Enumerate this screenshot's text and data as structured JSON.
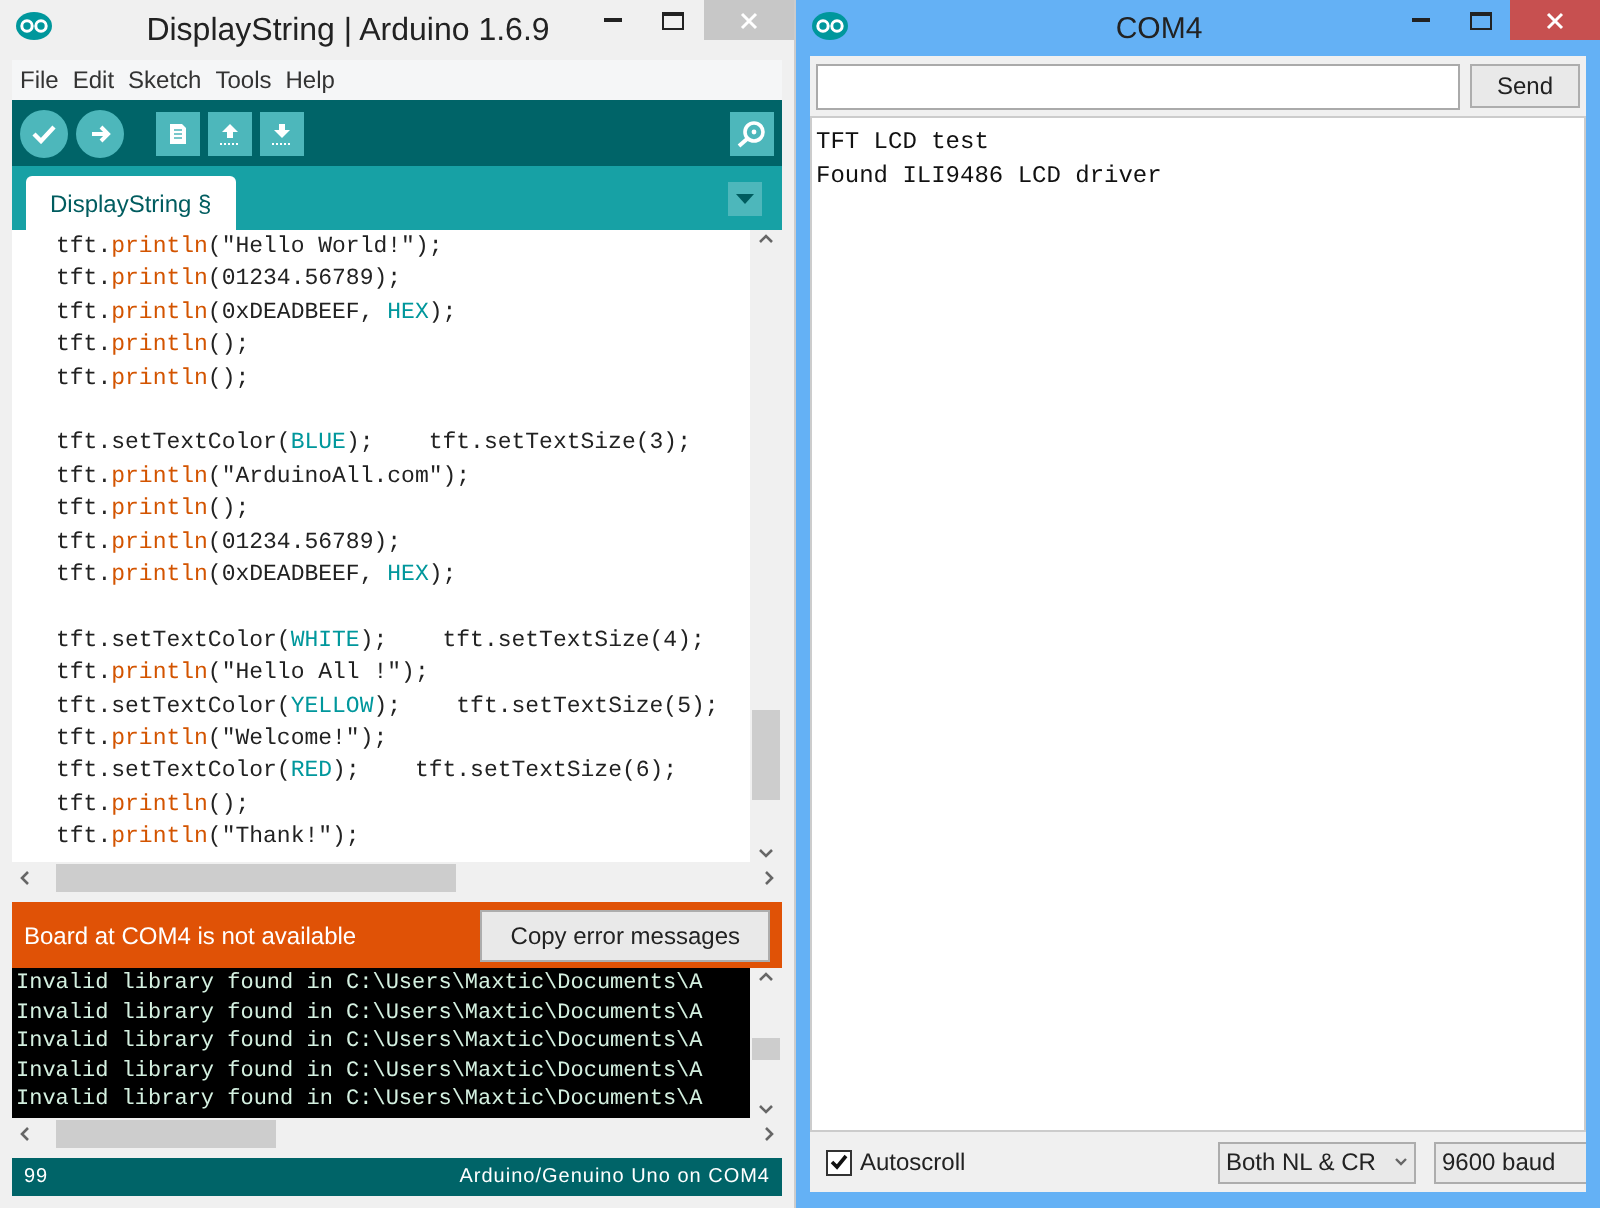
{
  "ide_window": {
    "title": "DisplayString | Arduino 1.6.9",
    "menu": [
      "File",
      "Edit",
      "Sketch",
      "Tools",
      "Help"
    ],
    "tabs": [
      {
        "label": "DisplayString §",
        "selected": true
      }
    ],
    "code_lines": [
      {
        "kind": "code",
        "tokens": [
          {
            "text": "tft.",
            "kind": "plain"
          },
          {
            "text": "println",
            "kind": "fn"
          },
          {
            "text": "(\"Hello World!\");",
            "kind": "plain"
          }
        ]
      },
      {
        "kind": "code",
        "tokens": [
          {
            "text": "tft.",
            "kind": "plain"
          },
          {
            "text": "println",
            "kind": "fn"
          },
          {
            "text": "(01234.56789);",
            "kind": "plain"
          }
        ]
      },
      {
        "kind": "code",
        "tokens": [
          {
            "text": "tft.",
            "kind": "plain"
          },
          {
            "text": "println",
            "kind": "fn"
          },
          {
            "text": "(0xDEADBEEF, ",
            "kind": "plain"
          },
          {
            "text": "HEX",
            "kind": "const"
          },
          {
            "text": ");",
            "kind": "plain"
          }
        ]
      },
      {
        "kind": "code",
        "tokens": [
          {
            "text": "tft.",
            "kind": "plain"
          },
          {
            "text": "println",
            "kind": "fn"
          },
          {
            "text": "();",
            "kind": "plain"
          }
        ]
      },
      {
        "kind": "code",
        "tokens": [
          {
            "text": "tft.",
            "kind": "plain"
          },
          {
            "text": "println",
            "kind": "fn"
          },
          {
            "text": "();",
            "kind": "plain"
          }
        ]
      },
      {
        "kind": "blank"
      },
      {
        "kind": "code",
        "tokens": [
          {
            "text": "tft.setTextColor(",
            "kind": "plain"
          },
          {
            "text": "BLUE",
            "kind": "const"
          },
          {
            "text": ");    tft.setTextSize(3);",
            "kind": "plain"
          }
        ]
      },
      {
        "kind": "code",
        "tokens": [
          {
            "text": "tft.",
            "kind": "plain"
          },
          {
            "text": "println",
            "kind": "fn"
          },
          {
            "text": "(\"ArduinoAll.com\");",
            "kind": "plain"
          }
        ]
      },
      {
        "kind": "code",
        "tokens": [
          {
            "text": "tft.",
            "kind": "plain"
          },
          {
            "text": "println",
            "kind": "fn"
          },
          {
            "text": "();",
            "kind": "plain"
          }
        ]
      },
      {
        "kind": "code",
        "tokens": [
          {
            "text": "tft.",
            "kind": "plain"
          },
          {
            "text": "println",
            "kind": "fn"
          },
          {
            "text": "(01234.56789);",
            "kind": "plain"
          }
        ]
      },
      {
        "kind": "code",
        "tokens": [
          {
            "text": "tft.",
            "kind": "plain"
          },
          {
            "text": "println",
            "kind": "fn"
          },
          {
            "text": "(0xDEADBEEF, ",
            "kind": "plain"
          },
          {
            "text": "HEX",
            "kind": "const"
          },
          {
            "text": ");",
            "kind": "plain"
          }
        ]
      },
      {
        "kind": "blank"
      },
      {
        "kind": "code",
        "tokens": [
          {
            "text": "tft.setTextColor(",
            "kind": "plain"
          },
          {
            "text": "WHITE",
            "kind": "const"
          },
          {
            "text": ");    tft.setTextSize(4);",
            "kind": "plain"
          }
        ]
      },
      {
        "kind": "code",
        "tokens": [
          {
            "text": "tft.",
            "kind": "plain"
          },
          {
            "text": "println",
            "kind": "fn"
          },
          {
            "text": "(\"Hello All !\");",
            "kind": "plain"
          }
        ]
      },
      {
        "kind": "code",
        "tokens": [
          {
            "text": "tft.setTextColor(",
            "kind": "plain"
          },
          {
            "text": "YELLOW",
            "kind": "const"
          },
          {
            "text": ");    tft.setTextSize(5);",
            "kind": "plain"
          }
        ]
      },
      {
        "kind": "code",
        "tokens": [
          {
            "text": "tft.",
            "kind": "plain"
          },
          {
            "text": "println",
            "kind": "fn"
          },
          {
            "text": "(\"Welcome!\");",
            "kind": "plain"
          }
        ]
      },
      {
        "kind": "code",
        "tokens": [
          {
            "text": "tft.setTextColor(",
            "kind": "plain"
          },
          {
            "text": "RED",
            "kind": "const"
          },
          {
            "text": ");    tft.setTextSize(6);",
            "kind": "plain"
          }
        ]
      },
      {
        "kind": "code",
        "tokens": [
          {
            "text": "tft.",
            "kind": "plain"
          },
          {
            "text": "println",
            "kind": "fn"
          },
          {
            "text": "();",
            "kind": "plain"
          }
        ]
      },
      {
        "kind": "code",
        "tokens": [
          {
            "text": "tft.",
            "kind": "plain"
          },
          {
            "text": "println",
            "kind": "fn"
          },
          {
            "text": "(\"Thank!\");",
            "kind": "plain"
          }
        ]
      }
    ],
    "error_bar": {
      "message": "Board at COM4 is not available",
      "button": "Copy error messages"
    },
    "console_lines": [
      "Invalid library found in C:\\Users\\Maxtic\\Documents\\A",
      "Invalid library found in C:\\Users\\Maxtic\\Documents\\A",
      "Invalid library found in C:\\Users\\Maxtic\\Documents\\A",
      "Invalid library found in C:\\Users\\Maxtic\\Documents\\A",
      "Invalid library found in C:\\Users\\Maxtic\\Documents\\A"
    ],
    "status_bar": {
      "line": "99",
      "board": "Arduino/Genuino Uno on COM4"
    }
  },
  "serial_window": {
    "title": "COM4",
    "send_button": "Send",
    "output_lines": [
      "TFT LCD test",
      "Found ILI9486 LCD driver"
    ],
    "autoscroll": {
      "label": "Autoscroll",
      "checked": true
    },
    "line_ending": "Both NL & CR",
    "baud": "9600 baud"
  }
}
